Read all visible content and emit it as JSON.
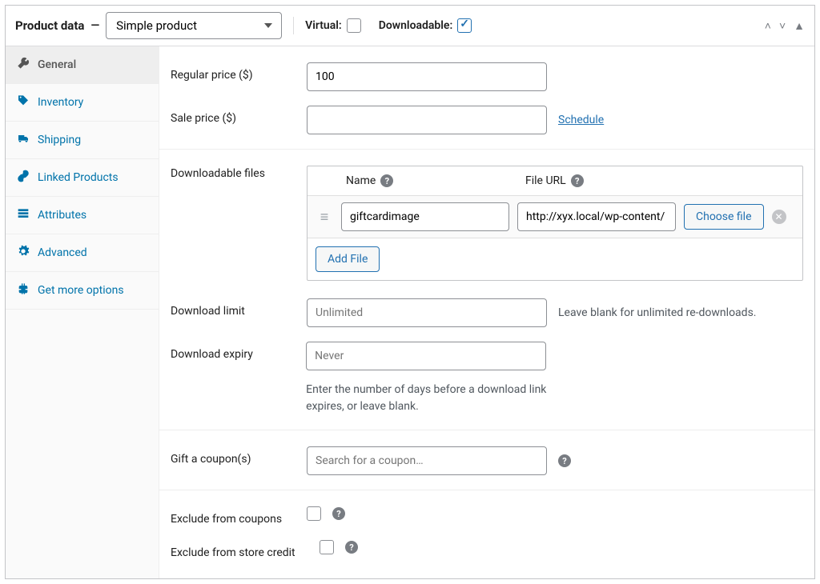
{
  "header": {
    "title": "Product data",
    "dash": "—",
    "product_type": "Simple product",
    "virtual_label": "Virtual:",
    "virtual_checked": false,
    "downloadable_label": "Downloadable:",
    "downloadable_checked": true
  },
  "tabs": [
    {
      "id": "general",
      "label": "General",
      "icon": "wrench",
      "active": true
    },
    {
      "id": "inventory",
      "label": "Inventory",
      "icon": "tag",
      "active": false
    },
    {
      "id": "shipping",
      "label": "Shipping",
      "icon": "truck",
      "active": false
    },
    {
      "id": "linked",
      "label": "Linked Products",
      "icon": "link",
      "active": false
    },
    {
      "id": "attributes",
      "label": "Attributes",
      "icon": "list",
      "active": false
    },
    {
      "id": "advanced",
      "label": "Advanced",
      "icon": "gear",
      "active": false
    },
    {
      "id": "more",
      "label": "Get more options",
      "icon": "plugin",
      "active": false
    }
  ],
  "fields": {
    "regular_price_label": "Regular price ($)",
    "regular_price_value": "100",
    "sale_price_label": "Sale price ($)",
    "sale_price_value": "",
    "schedule_link": "Schedule",
    "downloadable_files_label": "Downloadable files",
    "col_name": "Name",
    "col_url": "File URL",
    "file_name": "giftcardimage",
    "file_url": "http://xyx.local/wp-content/",
    "choose_file_btn": "Choose file",
    "add_file_btn": "Add File",
    "download_limit_label": "Download limit",
    "download_limit_placeholder": "Unlimited",
    "download_limit_hint": "Leave blank for unlimited re-downloads.",
    "download_expiry_label": "Download expiry",
    "download_expiry_placeholder": "Never",
    "download_expiry_hint": "Enter the number of days before a download link expires, or leave blank.",
    "gift_coupon_label": "Gift a coupon(s)",
    "gift_coupon_placeholder": "Search for a coupon…",
    "exclude_coupons_label": "Exclude from coupons",
    "exclude_store_credit_label": "Exclude from store credit"
  }
}
